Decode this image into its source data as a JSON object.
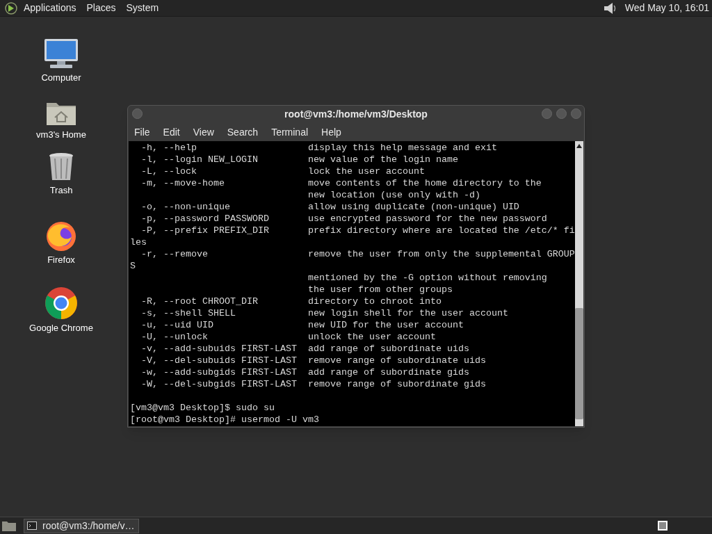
{
  "top_panel": {
    "menus": [
      "Applications",
      "Places",
      "System"
    ],
    "clock": "Wed May 10, 16:01"
  },
  "desktop_icons": [
    {
      "kind": "computer",
      "label": "Computer"
    },
    {
      "kind": "home",
      "label": "vm3's Home"
    },
    {
      "kind": "trash",
      "label": "Trash"
    },
    {
      "kind": "firefox",
      "label": "Firefox"
    },
    {
      "kind": "chrome",
      "label": "Google Chrome"
    }
  ],
  "window": {
    "title": "root@vm3:/home/vm3/Desktop",
    "menu": [
      "File",
      "Edit",
      "View",
      "Search",
      "Terminal",
      "Help"
    ],
    "output_lines": [
      "  -h, --help                    display this help message and exit",
      "  -l, --login NEW_LOGIN         new value of the login name",
      "  -L, --lock                    lock the user account",
      "  -m, --move-home               move contents of the home directory to the",
      "                                new location (use only with -d)",
      "  -o, --non-unique              allow using duplicate (non-unique) UID",
      "  -p, --password PASSWORD       use encrypted password for the new password",
      "  -P, --prefix PREFIX_DIR       prefix directory where are located the /etc/* fi",
      "les",
      "  -r, --remove                  remove the user from only the supplemental GROUP",
      "S",
      "                                mentioned by the -G option without removing",
      "                                the user from other groups",
      "  -R, --root CHROOT_DIR         directory to chroot into",
      "  -s, --shell SHELL             new login shell for the user account",
      "  -u, --uid UID                 new UID for the user account",
      "  -U, --unlock                  unlock the user account",
      "  -v, --add-subuids FIRST-LAST  add range of subordinate uids",
      "  -V, --del-subuids FIRST-LAST  remove range of subordinate uids",
      "  -w, --add-subgids FIRST-LAST  add range of subordinate gids",
      "  -W, --del-subgids FIRST-LAST  remove range of subordinate gids"
    ],
    "prompt_lines": [
      "[vm3@vm3 Desktop]$ sudo su",
      "[root@vm3 Desktop]# usermod -U vm3"
    ]
  },
  "taskbar": {
    "tasks": [
      {
        "label": "root@vm3:/home/v…",
        "selected": false
      }
    ]
  }
}
